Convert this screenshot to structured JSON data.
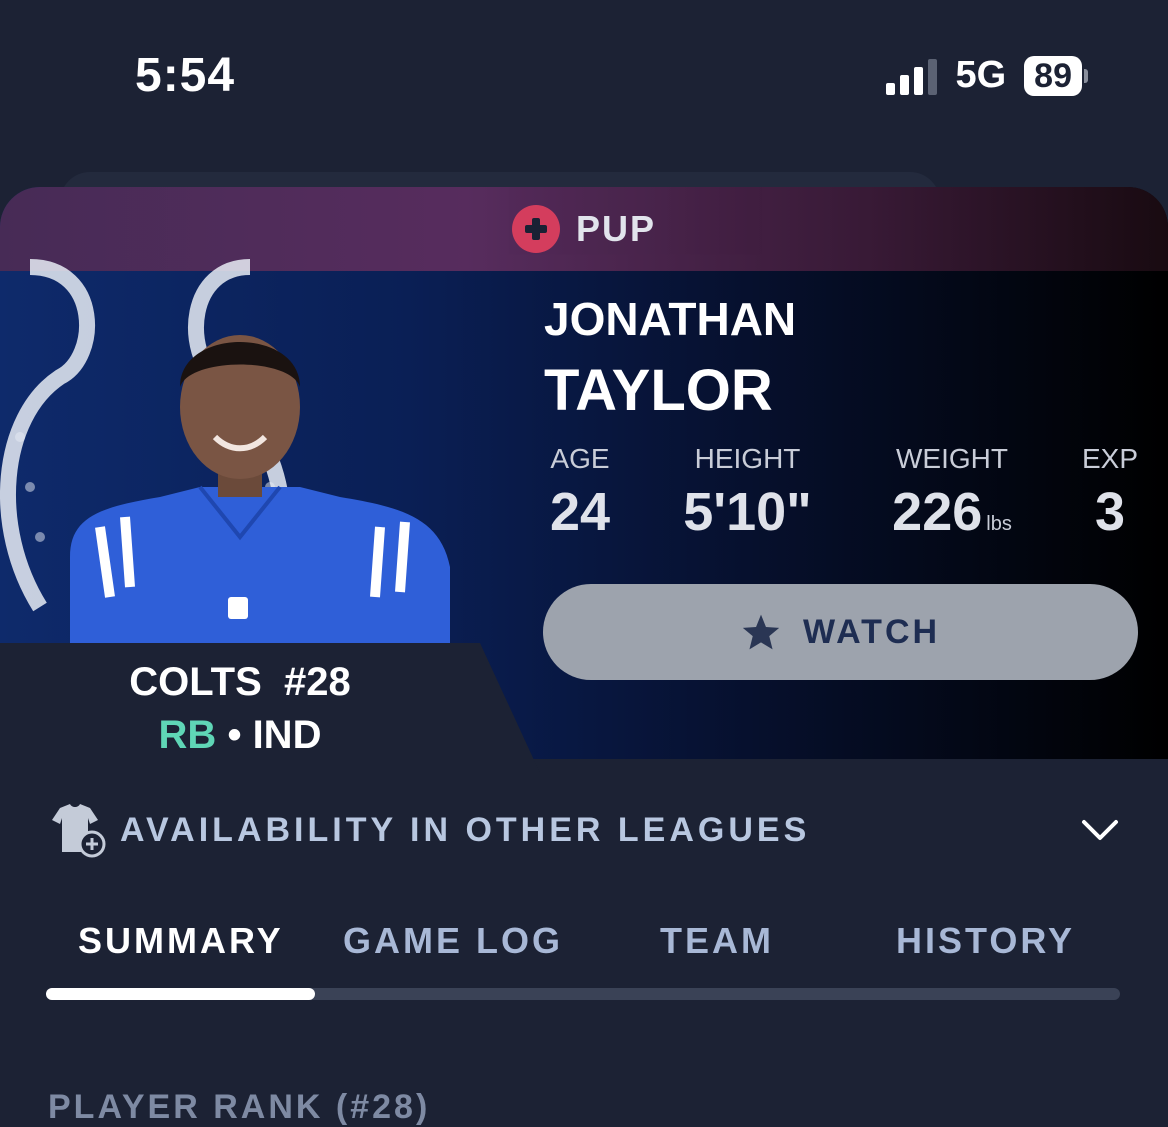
{
  "status_bar": {
    "time": "5:54",
    "network": "5G",
    "battery": "89"
  },
  "player": {
    "injury_status": "PUP",
    "first_name": "JONATHAN",
    "last_name": "TAYLOR",
    "team_number": "COLTS  #28",
    "position": "RB",
    "separator": " • ",
    "team_abbr": "IND"
  },
  "stats": [
    {
      "label": "AGE",
      "value": "24",
      "unit": ""
    },
    {
      "label": "HEIGHT",
      "value": "5'10\"",
      "unit": ""
    },
    {
      "label": "WEIGHT",
      "value": "226",
      "unit": "lbs"
    },
    {
      "label": "EXP",
      "value": "3",
      "unit": ""
    }
  ],
  "watch_button": {
    "label": "WATCH"
  },
  "availability": {
    "label": "AVAILABILITY IN OTHER LEAGUES"
  },
  "tabs": [
    {
      "label": "SUMMARY",
      "active": true
    },
    {
      "label": "GAME LOG",
      "active": false
    },
    {
      "label": "TEAM",
      "active": false
    },
    {
      "label": "HISTORY",
      "active": false
    }
  ],
  "next_section": {
    "heading_partial": "PLAYER RANK (#28)"
  },
  "colors": {
    "background": "#1c2234",
    "accent_rb": "#5fd6b6",
    "pup_red": "#e0405f",
    "watch_button": "#9da3ad"
  }
}
